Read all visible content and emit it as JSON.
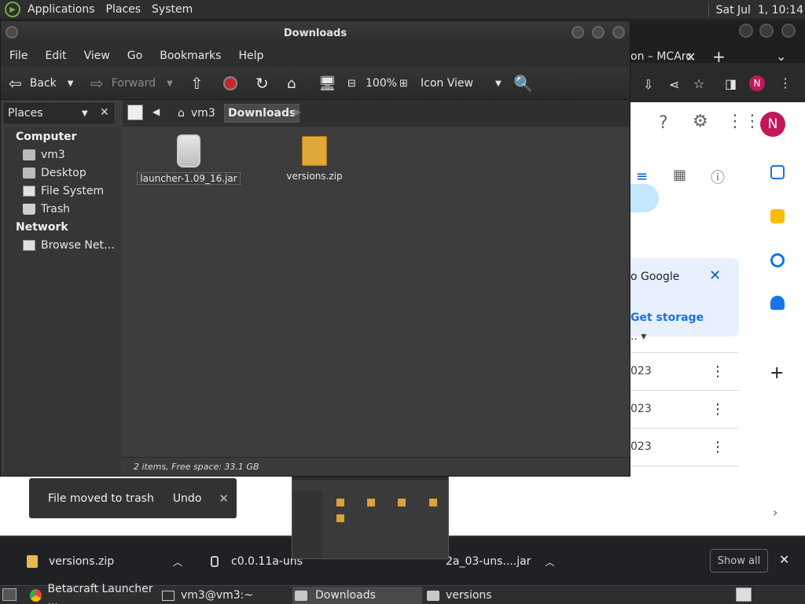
{
  "top_panel": {
    "menus": [
      "Applications",
      "Places",
      "System"
    ],
    "clock": "Sat Jul  1, 10:14"
  },
  "chrome": {
    "tab_title": "on – MCArc",
    "storage_card": {
      "text": "o Google",
      "link": "Get storage"
    },
    "list_header": "..",
    "rows": [
      "023",
      "023",
      "023"
    ],
    "avatar_letter": "N",
    "accent": "#1a73e8",
    "avatar_color": "#c2185b"
  },
  "file_manager": {
    "title": "Downloads",
    "menu": [
      "File",
      "Edit",
      "View",
      "Go",
      "Bookmarks",
      "Help"
    ],
    "toolbar": {
      "back": "Back",
      "forward": "Forward",
      "zoom": "100%",
      "view_mode": "Icon View"
    },
    "places_label": "Places",
    "sidebar": {
      "computer_heading": "Computer",
      "computer_items": [
        "vm3",
        "Desktop",
        "File System",
        "Trash"
      ],
      "network_heading": "Network",
      "network_items": [
        "Browse Net…"
      ]
    },
    "path": [
      "vm3",
      "Downloads"
    ],
    "files": [
      {
        "name": "launcher-1.09_16.jar",
        "icon": "jar-icon"
      },
      {
        "name": "versions.zip",
        "icon": "zip-icon"
      }
    ],
    "status": "2 items, Free space: 33.1 GB"
  },
  "snackbar": {
    "message": "File moved to trash",
    "action": "Undo"
  },
  "download_shelf": {
    "items": [
      "versions.zip",
      "c0.0.11a-uns",
      "2a_03-uns....jar"
    ],
    "show_all": "Show all"
  },
  "taskbar": {
    "items": [
      "Betacraft Launcher ...",
      "vm3@vm3:~",
      "Downloads",
      "versions"
    ]
  }
}
